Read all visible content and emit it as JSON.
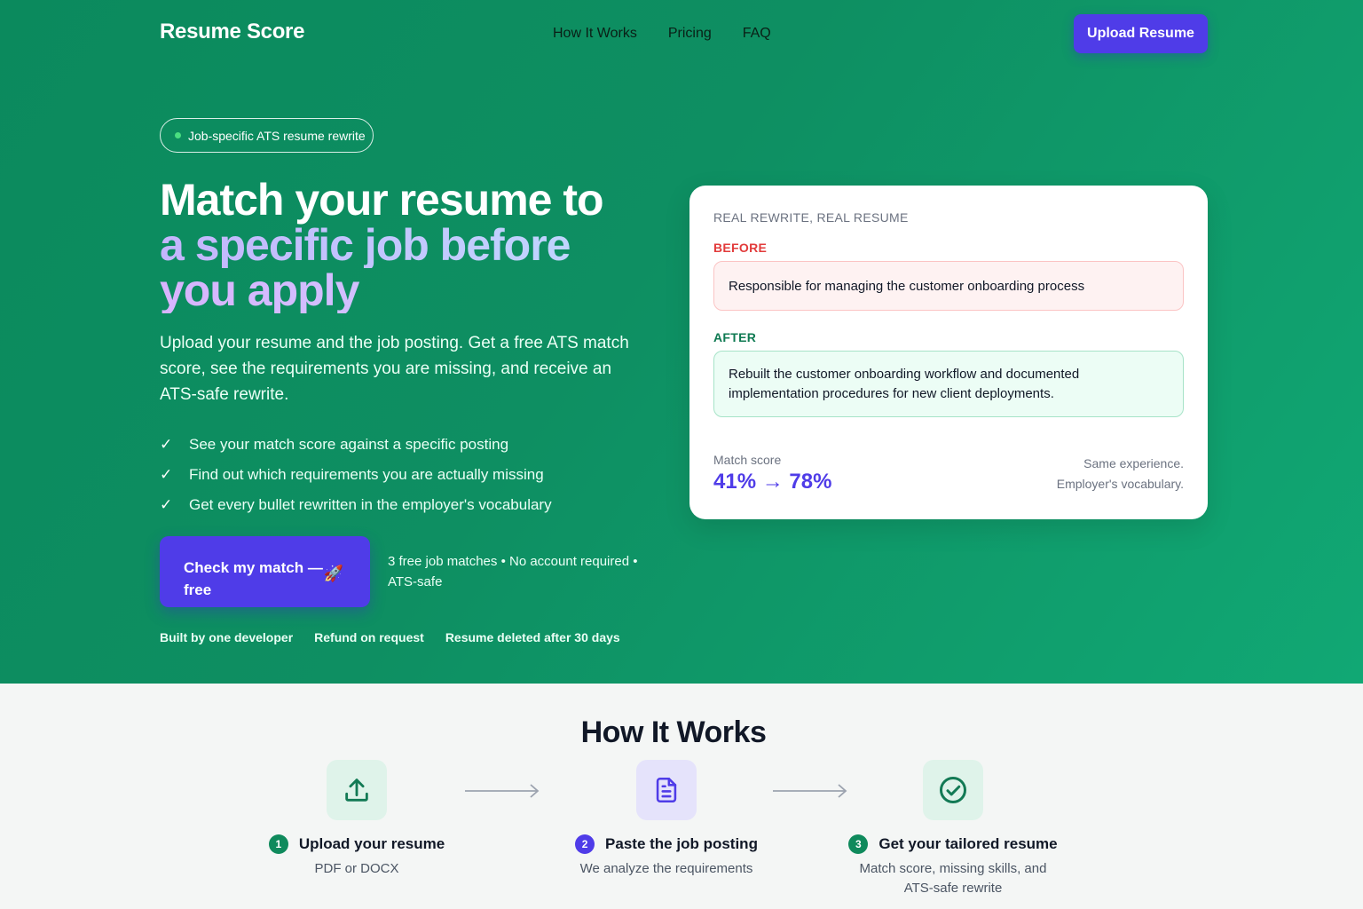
{
  "brand": "Resume Score",
  "nav": {
    "how": "How It Works",
    "pricing": "Pricing",
    "faq": "FAQ"
  },
  "header_cta": "Upload Resume",
  "hero": {
    "pill": "Job-specific ATS resume rewrite",
    "headline_1": "Match your resume to",
    "headline_2": "a specific job before",
    "headline_3": "you apply",
    "subtitle": "Upload your resume and the job posting. Get a free ATS match score, see the requirements you are missing, and receive an ATS-safe rewrite.",
    "checks": [
      "See your match score against a specific posting",
      "Find out which requirements you are actually missing",
      "Get every bullet rewritten in the employer's vocabulary"
    ],
    "cta": "Check my match — free",
    "cta_note": "3 free job matches • No account required • ATS-safe",
    "trust": [
      "Built by one developer",
      "Refund on request",
      "Resume deleted after 30 days"
    ]
  },
  "card": {
    "kicker": "REAL REWRITE, REAL RESUME",
    "before_label": "BEFORE",
    "before_text": "Responsible for managing the customer onboarding process",
    "after_label": "AFTER",
    "after_text": "Rebuilt the customer onboarding workflow and documented implementation procedures for new client deployments.",
    "match_label": "Match score",
    "match_value": "41% → 78%",
    "note_1": "Same experience.",
    "note_2": "Employer's vocabulary."
  },
  "how_it_works": {
    "title": "How It Works",
    "steps": [
      {
        "num": "1",
        "title": "Upload your resume",
        "desc": "PDF or DOCX",
        "icon": "upload-icon"
      },
      {
        "num": "2",
        "title": "Paste the job posting",
        "desc": "We analyze the requirements",
        "icon": "document-icon"
      },
      {
        "num": "3",
        "title": "Get your tailored resume",
        "desc": "Match score, missing skills, and ATS-safe rewrite",
        "icon": "check-circle-icon"
      }
    ]
  },
  "colors": {
    "hero_green": "#0e8f62",
    "accent_purple": "#4f3ce8",
    "before_red": "#e23b3b",
    "after_green": "#0f7a52"
  }
}
